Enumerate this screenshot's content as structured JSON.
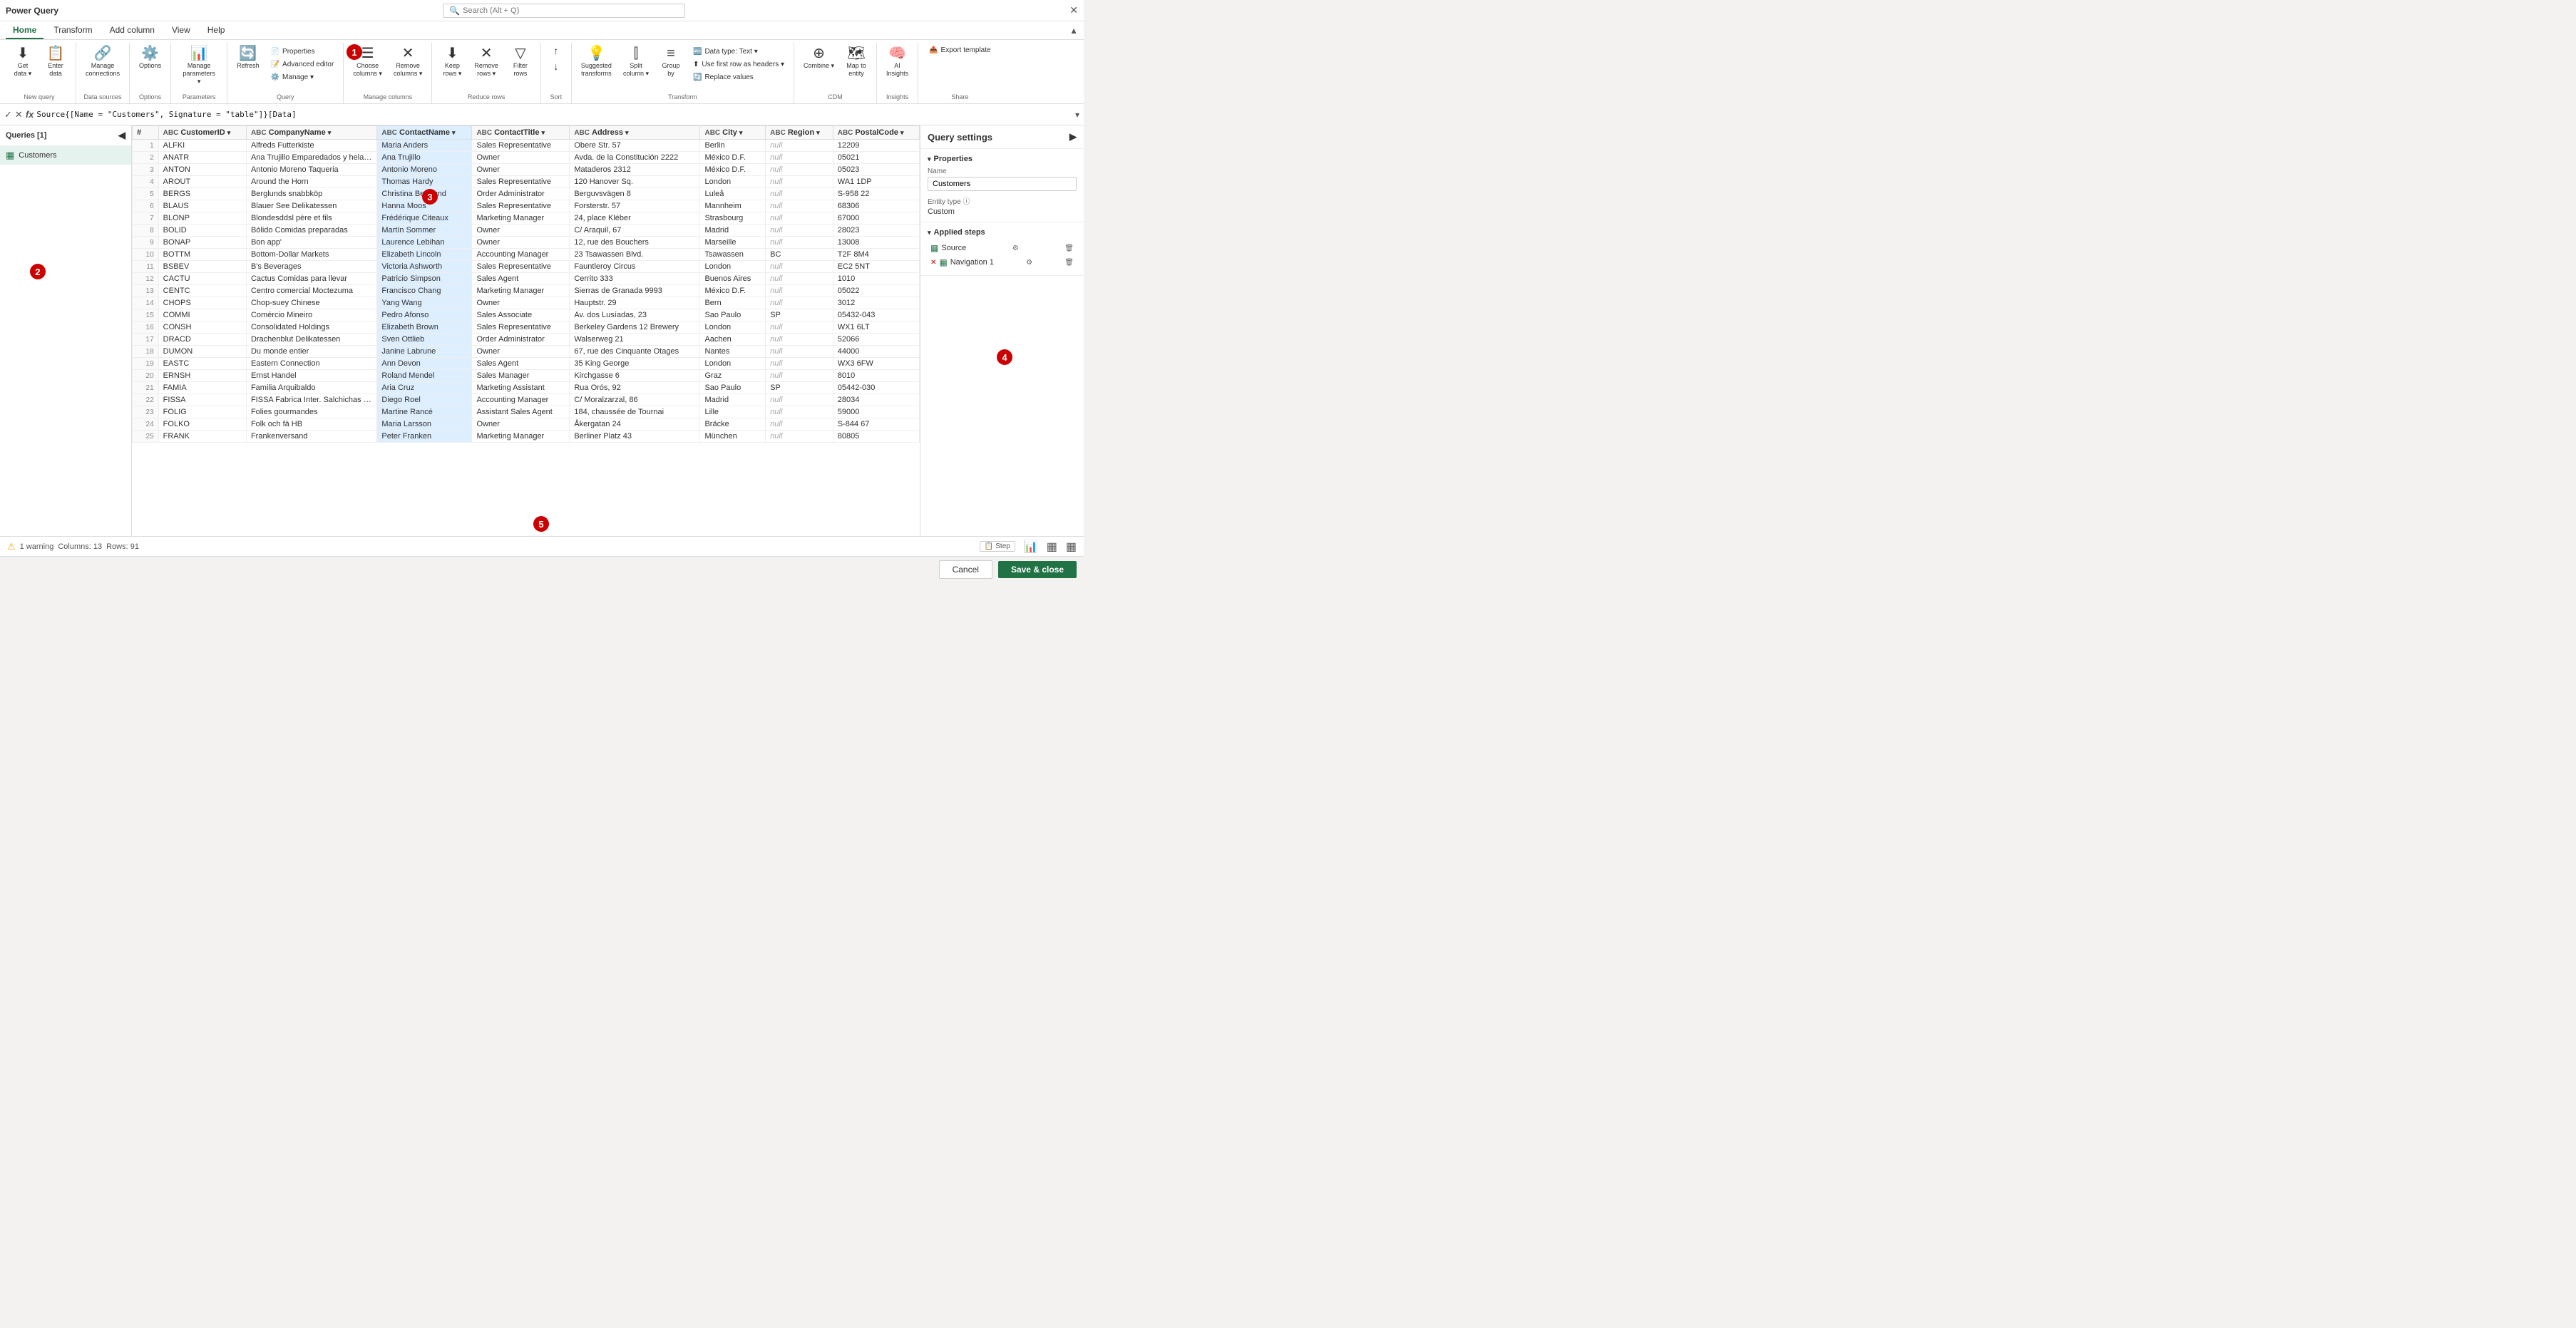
{
  "titleBar": {
    "title": "Power Query",
    "searchPlaceholder": "Search (Alt + Q)",
    "closeLabel": "✕"
  },
  "tabs": [
    {
      "id": "home",
      "label": "Home",
      "active": true
    },
    {
      "id": "transform",
      "label": "Transform",
      "active": false
    },
    {
      "id": "addColumn",
      "label": "Add column",
      "active": false
    },
    {
      "id": "view",
      "label": "View",
      "active": false
    },
    {
      "id": "help",
      "label": "Help",
      "active": false
    }
  ],
  "ribbon": {
    "groups": [
      {
        "id": "newQuery",
        "label": "New query",
        "items": [
          {
            "id": "getData",
            "icon": "⬇️",
            "label": "Get\ndata ▾",
            "hasDropdown": true
          },
          {
            "id": "enterData",
            "icon": "📋",
            "label": "Enter\ndata",
            "hasDropdown": false
          }
        ]
      },
      {
        "id": "dataSources",
        "label": "Data sources",
        "items": [
          {
            "id": "manageConnections",
            "icon": "🔗",
            "label": "Manage\nconnections",
            "hasDropdown": false
          }
        ]
      },
      {
        "id": "options",
        "label": "Options",
        "items": [
          {
            "id": "options",
            "icon": "⚙️",
            "label": "Options",
            "hasDropdown": false
          }
        ]
      },
      {
        "id": "parameters",
        "label": "Parameters",
        "items": [
          {
            "id": "manageParameters",
            "icon": "📊",
            "label": "Manage\nparameters ▾",
            "hasDropdown": true
          }
        ]
      },
      {
        "id": "query",
        "label": "Query",
        "items": [
          {
            "id": "refresh",
            "icon": "🔄",
            "label": "Refresh",
            "hasDropdown": false
          },
          {
            "id": "properties",
            "icon": "📄",
            "label": "Properties",
            "isSmall": true
          },
          {
            "id": "advancedEditor",
            "icon": "📝",
            "label": "Advanced editor",
            "isSmall": true
          },
          {
            "id": "manage",
            "icon": "⚙️",
            "label": "Manage ▾",
            "isSmall": true
          }
        ]
      },
      {
        "id": "manageColumns",
        "label": "Manage columns",
        "items": [
          {
            "id": "chooseColumns",
            "icon": "☰",
            "label": "Choose\ncolumns ▾",
            "hasDropdown": true
          },
          {
            "id": "removeColumns",
            "icon": "✕",
            "label": "Remove\ncolumns ▾",
            "hasDropdown": true
          }
        ]
      },
      {
        "id": "reduceRows",
        "label": "Reduce rows",
        "items": [
          {
            "id": "keepRows",
            "icon": "⬇",
            "label": "Keep\nrows ▾",
            "hasDropdown": true
          },
          {
            "id": "removeRows",
            "icon": "✕",
            "label": "Remove\nrows ▾",
            "hasDropdown": true
          },
          {
            "id": "filterRows",
            "icon": "▽",
            "label": "Filter\nrows",
            "hasDropdown": false
          }
        ]
      },
      {
        "id": "sort",
        "label": "Sort",
        "items": [
          {
            "id": "sortAsc",
            "icon": "↑",
            "label": ""
          },
          {
            "id": "sortDesc",
            "icon": "↓",
            "label": ""
          }
        ]
      },
      {
        "id": "transform",
        "label": "Transform",
        "items": [
          {
            "id": "suggestedTransforms",
            "icon": "💡",
            "label": "Suggested\ntransforms"
          },
          {
            "id": "splitColumn",
            "icon": "⫿",
            "label": "Split\ncolumn ▾",
            "hasDropdown": true
          },
          {
            "id": "groupBy",
            "icon": "≡",
            "label": "Group\nby"
          },
          {
            "id": "dataType",
            "icon": "🔤",
            "label": "Data type: Text ▾",
            "isSmall": true
          },
          {
            "id": "useFirstRow",
            "icon": "⬆",
            "label": "Use first row as headers ▾",
            "isSmall": true
          },
          {
            "id": "replaceValues",
            "icon": "🔄",
            "label": "Replace values",
            "isSmall": true
          }
        ]
      },
      {
        "id": "cdm",
        "label": "CDM",
        "items": [
          {
            "id": "combine",
            "icon": "⊕",
            "label": "Combine ▾",
            "hasDropdown": true
          },
          {
            "id": "mapToEntity",
            "icon": "🗺",
            "label": "Map to\nentity"
          }
        ]
      },
      {
        "id": "insights",
        "label": "Insights",
        "items": [
          {
            "id": "aiInsights",
            "icon": "🧠",
            "label": "AI\nInsights"
          }
        ]
      },
      {
        "id": "share",
        "label": "Share",
        "items": [
          {
            "id": "exportTemplate",
            "icon": "📤",
            "label": "Export template",
            "isSmall": true
          }
        ]
      }
    ]
  },
  "formulaBar": {
    "content": "Source{[Name = \"Customers\", Signature = \"table\"]}[Data]"
  },
  "queriesPanel": {
    "header": "Queries [1]",
    "items": [
      {
        "id": "customers",
        "icon": "▦",
        "label": "Customers",
        "selected": true
      }
    ]
  },
  "table": {
    "columns": [
      {
        "id": "rowNum",
        "label": "#",
        "type": ""
      },
      {
        "id": "customerID",
        "label": "CustomerID",
        "type": "ABC"
      },
      {
        "id": "companyName",
        "label": "CompanyName",
        "type": "ABC"
      },
      {
        "id": "contactName",
        "label": "ContactName",
        "type": "ABC"
      },
      {
        "id": "contactTitle",
        "label": "ContactTitle",
        "type": "ABC"
      },
      {
        "id": "address",
        "label": "Address",
        "type": "ABC"
      },
      {
        "id": "city",
        "label": "City",
        "type": "ABC"
      },
      {
        "id": "region",
        "label": "Region",
        "type": "ABC"
      },
      {
        "id": "postalCode",
        "label": "PostalCode",
        "type": "ABC"
      }
    ],
    "rows": [
      {
        "num": "1",
        "customerID": "ALFKI",
        "companyName": "Alfreds Futterkiste",
        "contactName": "Maria Anders",
        "contactTitle": "Sales Representative",
        "address": "Obere Str. 57",
        "city": "Berlin",
        "region": "null",
        "postalCode": "12209"
      },
      {
        "num": "2",
        "customerID": "ANATR",
        "companyName": "Ana Trujillo Emparedados y helados",
        "contactName": "Ana Trujillo",
        "contactTitle": "Owner",
        "address": "Avda. de la Constitución 2222",
        "city": "México D.F.",
        "region": "null",
        "postalCode": "05021"
      },
      {
        "num": "3",
        "customerID": "ANTON",
        "companyName": "Antonio Moreno Taqueria",
        "contactName": "Antonio Moreno",
        "contactTitle": "Owner",
        "address": "Mataderos 2312",
        "city": "México D.F.",
        "region": "null",
        "postalCode": "05023"
      },
      {
        "num": "4",
        "customerID": "AROUT",
        "companyName": "Around the Horn",
        "contactName": "Thomas Hardy",
        "contactTitle": "Sales Representative",
        "address": "120 Hanover Sq.",
        "city": "London",
        "region": "null",
        "postalCode": "WA1 1DP"
      },
      {
        "num": "5",
        "customerID": "BERGS",
        "companyName": "Berglunds snabbköp",
        "contactName": "Christina Berglund",
        "contactTitle": "Order Administrator",
        "address": "Berguvsvägen 8",
        "city": "Luleå",
        "region": "null",
        "postalCode": "S-958 22"
      },
      {
        "num": "6",
        "customerID": "BLAUS",
        "companyName": "Blauer See Delikatessen",
        "contactName": "Hanna Moos",
        "contactTitle": "Sales Representative",
        "address": "Forsterstr. 57",
        "city": "Mannheim",
        "region": "null",
        "postalCode": "68306"
      },
      {
        "num": "7",
        "customerID": "BLONP",
        "companyName": "Blondesddsl père et fils",
        "contactName": "Frédérique Citeaux",
        "contactTitle": "Marketing Manager",
        "address": "24, place Kléber",
        "city": "Strasbourg",
        "region": "null",
        "postalCode": "67000"
      },
      {
        "num": "8",
        "customerID": "BOLID",
        "companyName": "Bólido Comidas preparadas",
        "contactName": "Martín Sommer",
        "contactTitle": "Owner",
        "address": "C/ Araquil, 67",
        "city": "Madrid",
        "region": "null",
        "postalCode": "28023"
      },
      {
        "num": "9",
        "customerID": "BONAP",
        "companyName": "Bon app'",
        "contactName": "Laurence Lebihan",
        "contactTitle": "Owner",
        "address": "12, rue des Bouchers",
        "city": "Marseille",
        "region": "null",
        "postalCode": "13008"
      },
      {
        "num": "10",
        "customerID": "BOTTM",
        "companyName": "Bottom-Dollar Markets",
        "contactName": "Elizabeth Lincoln",
        "contactTitle": "Accounting Manager",
        "address": "23 Tsawassen Blvd.",
        "city": "Tsawassen",
        "region": "BC",
        "postalCode": "T2F 8M4"
      },
      {
        "num": "11",
        "customerID": "BSBEV",
        "companyName": "B's Beverages",
        "contactName": "Victoria Ashworth",
        "contactTitle": "Sales Representative",
        "address": "Fauntleroy Circus",
        "city": "London",
        "region": "null",
        "postalCode": "EC2 5NT"
      },
      {
        "num": "12",
        "customerID": "CACTU",
        "companyName": "Cactus Comidas para llevar",
        "contactName": "Patricio Simpson",
        "contactTitle": "Sales Agent",
        "address": "Cerrito 333",
        "city": "Buenos Aires",
        "region": "null",
        "postalCode": "1010"
      },
      {
        "num": "13",
        "customerID": "CENTC",
        "companyName": "Centro comercial Moctezuma",
        "contactName": "Francisco Chang",
        "contactTitle": "Marketing Manager",
        "address": "Sierras de Granada 9993",
        "city": "México D.F.",
        "region": "null",
        "postalCode": "05022"
      },
      {
        "num": "14",
        "customerID": "CHOPS",
        "companyName": "Chop-suey Chinese",
        "contactName": "Yang Wang",
        "contactTitle": "Owner",
        "address": "Hauptstr. 29",
        "city": "Bern",
        "region": "null",
        "postalCode": "3012"
      },
      {
        "num": "15",
        "customerID": "COMMI",
        "companyName": "Comércio Mineiro",
        "contactName": "Pedro Afonso",
        "contactTitle": "Sales Associate",
        "address": "Av. dos Lusíadas, 23",
        "city": "Sao Paulo",
        "region": "SP",
        "postalCode": "05432-043"
      },
      {
        "num": "16",
        "customerID": "CONSH",
        "companyName": "Consolidated Holdings",
        "contactName": "Elizabeth Brown",
        "contactTitle": "Sales Representative",
        "address": "Berkeley Gardens 12 Brewery",
        "city": "London",
        "region": "null",
        "postalCode": "WX1 6LT"
      },
      {
        "num": "17",
        "customerID": "DRACD",
        "companyName": "Drachenblut Delikatessen",
        "contactName": "Sven Ottlieb",
        "contactTitle": "Order Administrator",
        "address": "Walserweg 21",
        "city": "Aachen",
        "region": "null",
        "postalCode": "52066"
      },
      {
        "num": "18",
        "customerID": "DUMON",
        "companyName": "Du monde entier",
        "contactName": "Janine Labrune",
        "contactTitle": "Owner",
        "address": "67, rue des Cinquante Otages",
        "city": "Nantes",
        "region": "null",
        "postalCode": "44000"
      },
      {
        "num": "19",
        "customerID": "EASTC",
        "companyName": "Eastern Connection",
        "contactName": "Ann Devon",
        "contactTitle": "Sales Agent",
        "address": "35 King George",
        "city": "London",
        "region": "null",
        "postalCode": "WX3 6FW"
      },
      {
        "num": "20",
        "customerID": "ERNSH",
        "companyName": "Ernst Handel",
        "contactName": "Roland Mendel",
        "contactTitle": "Sales Manager",
        "address": "Kirchgasse 6",
        "city": "Graz",
        "region": "null",
        "postalCode": "8010"
      },
      {
        "num": "21",
        "customerID": "FAMIA",
        "companyName": "Familia Arquibaldo",
        "contactName": "Aria Cruz",
        "contactTitle": "Marketing Assistant",
        "address": "Rua Orós, 92",
        "city": "Sao Paulo",
        "region": "SP",
        "postalCode": "05442-030"
      },
      {
        "num": "22",
        "customerID": "FISSA",
        "companyName": "FISSA Fabrica Inter. Salchichas S.A.",
        "contactName": "Diego Roel",
        "contactTitle": "Accounting Manager",
        "address": "C/ Moralzarzal, 86",
        "city": "Madrid",
        "region": "null",
        "postalCode": "28034"
      },
      {
        "num": "23",
        "customerID": "FOLIG",
        "companyName": "Folies gourmandes",
        "contactName": "Martine Rancé",
        "contactTitle": "Assistant Sales Agent",
        "address": "184, chaussée de Tournai",
        "city": "Lille",
        "region": "null",
        "postalCode": "59000"
      },
      {
        "num": "24",
        "customerID": "FOLKO",
        "companyName": "Folk och fä HB",
        "contactName": "Maria Larsson",
        "contactTitle": "Owner",
        "address": "Åkergatan 24",
        "city": "Bräcke",
        "region": "null",
        "postalCode": "S-844 67"
      },
      {
        "num": "25",
        "customerID": "FRANK",
        "companyName": "Frankenversand",
        "contactName": "Peter Franken",
        "contactTitle": "Marketing Manager",
        "address": "Berliner Platz 43",
        "city": "München",
        "region": "null",
        "postalCode": "80805"
      }
    ]
  },
  "rightPanel": {
    "header": "Query settings",
    "propertiesSection": {
      "title": "Properties",
      "nameLabel": "Name",
      "nameValue": "Customers",
      "entityTypeLabel": "Entity type",
      "entityTypeInfo": "ⓘ",
      "entityTypeValue": "Custom"
    },
    "appliedStepsSection": {
      "title": "Applied steps",
      "steps": [
        {
          "id": "source",
          "icon": "▦",
          "label": "Source",
          "hasSettings": true,
          "hasNav": false,
          "hasX": false
        },
        {
          "id": "navigation1",
          "icon": "▦",
          "label": "Navigation 1",
          "hasSettings": true,
          "hasNav": true,
          "hasX": true
        }
      ]
    }
  },
  "statusBar": {
    "warning": "⚠ 1 warning",
    "columns": "Columns: 13",
    "rows": "Rows: 91",
    "badges": {
      "step": "Step",
      "profileTable": "📊",
      "grid1": "▦",
      "grid2": "▦"
    }
  },
  "bottomBar": {
    "cancelLabel": "Cancel",
    "saveLabel": "Save & close"
  },
  "badges": [
    {
      "id": "badge1",
      "number": "1"
    },
    {
      "id": "badge2",
      "number": "2"
    },
    {
      "id": "badge3",
      "number": "3"
    },
    {
      "id": "badge4",
      "number": "4"
    },
    {
      "id": "badge5",
      "number": "5"
    }
  ]
}
